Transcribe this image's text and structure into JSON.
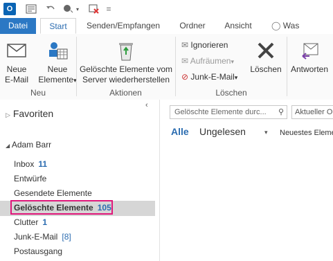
{
  "qat": {
    "logo": "O",
    "dropdown": "="
  },
  "tabs": {
    "file": "Datei",
    "start": "Start",
    "send": "Senden/Empfangen",
    "folder": "Ordner",
    "view": "Ansicht",
    "tell": "Was möchten"
  },
  "ribbon": {
    "new_email": [
      "Neue",
      "E-Mail"
    ],
    "new_items": [
      "Neue",
      "Elemente"
    ],
    "group_new": "Neu",
    "recover": [
      "Gelöschte Elemente vom",
      "Server wiederherstellen"
    ],
    "group_actions": "Aktionen",
    "ignore": "Ignorieren",
    "cleanup": "Aufräumen",
    "junk": "Junk-E-Mail",
    "delete": "Löschen",
    "group_delete": "Löschen",
    "reply": "Antworten"
  },
  "nav": {
    "favorites": "Favoriten",
    "account": "Adam Barr",
    "folders": [
      {
        "name": "Inbox",
        "count": "11"
      },
      {
        "name": "Entwürfe",
        "count": ""
      },
      {
        "name": "Gesendete Elemente",
        "count": ""
      },
      {
        "name": "Gelöschte Elemente",
        "count": "105"
      },
      {
        "name": "Clutter",
        "count": "1"
      },
      {
        "name": "Junk-E-Mail",
        "count": "[8]"
      },
      {
        "name": "Postausgang",
        "count": ""
      }
    ]
  },
  "main": {
    "search_placeholder": "Gelöschte Elemente durc...",
    "scope": "Aktueller O",
    "filter_all": "Alle",
    "filter_unread": "Ungelesen",
    "sort": "Neuestes Eleme"
  },
  "colors": {
    "accent": "#2b78c4",
    "highlight": "#e0177a",
    "selected": "#d6d6d6"
  }
}
